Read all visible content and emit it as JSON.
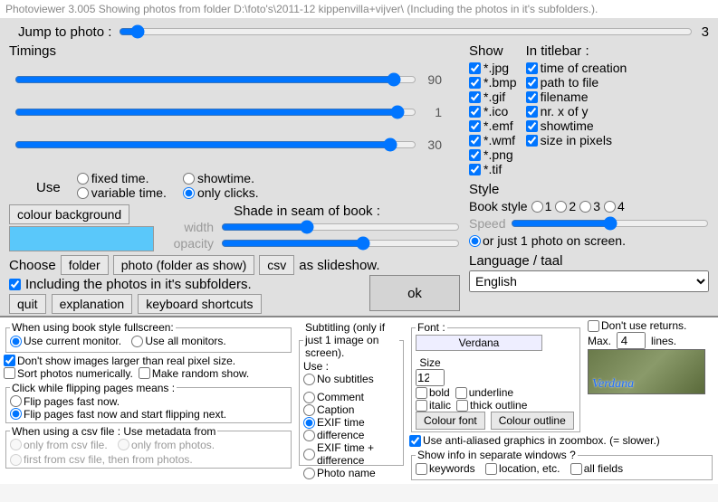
{
  "titlebar": "Photoviewer 3.005   Showing photos from folder D:\\foto's\\2011-12 kippenvilla+vijver\\  (Including the photos in it's subfolders.).",
  "jump": {
    "label": "Jump to photo :",
    "value": "3"
  },
  "timings": {
    "heading": "Timings",
    "vals": [
      "90",
      "1",
      "30"
    ],
    "use_label": "Use",
    "opts": {
      "fixed": "fixed time.",
      "showtime": "showtime.",
      "variable": "variable time.",
      "clicks": "only clicks."
    }
  },
  "colour_bg_btn": "colour background",
  "shade": {
    "title": "Shade in seam of book :",
    "width": "width",
    "opacity": "opacity"
  },
  "choose": {
    "label": "Choose",
    "folder": "folder",
    "photo": "photo (folder as show)",
    "csv": "csv",
    "tail": "as slideshow.",
    "subfolders": "Including the photos in it's subfolders."
  },
  "buttons": {
    "quit": "quit",
    "explanation": "explanation",
    "shortcuts": "keyboard shortcuts",
    "ok": "ok"
  },
  "show": {
    "heading": "Show",
    "items": [
      "*.jpg",
      "*.bmp",
      "*.gif",
      "*.ico",
      "*.emf",
      "*.wmf",
      "*.png",
      "*.tif"
    ]
  },
  "titlebar_opts": {
    "heading": "In titlebar :",
    "items": [
      "time of creation",
      "path to file",
      "filename",
      "nr. x of y",
      "showtime",
      "size in pixels"
    ]
  },
  "style": {
    "heading": "Style",
    "book_label": "Book style",
    "opts": [
      "1",
      "2",
      "3",
      "4"
    ],
    "speed": "Speed",
    "one_photo": "or just 1 photo on screen."
  },
  "language": {
    "heading": "Language / taal",
    "value": "English"
  },
  "fullscreen": {
    "legend": "When using book style fullscreen:",
    "current": "Use current monitor.",
    "all": "Use all monitors."
  },
  "dontshow": "Don't show images larger than real pixel size.",
  "sortnum": "Sort photos numerically.",
  "random": "Make random show.",
  "flip": {
    "legend": "Click while flipping pages means :",
    "fast": "Flip pages fast now.",
    "fastnext": "Flip pages fast now and start flipping next."
  },
  "csvmeta": {
    "legend": "When using a csv file : Use metadata from",
    "csv": "only from csv file.",
    "photos": "only from photos.",
    "both": "first from csv file, then from photos."
  },
  "subtitling": {
    "legend": "Subtitling (only if just 1 image on screen).",
    "use": "Use :",
    "none": "No subtitles",
    "comment": "Comment",
    "caption": "Caption",
    "exif": "EXIF time",
    "diff": "difference",
    "exifdiff": "EXIF time + difference",
    "photoname": "Photo name"
  },
  "font": {
    "legend": "Font :",
    "name": "Verdana",
    "size_label": "Size",
    "size": "12",
    "bold": "bold",
    "underline": "underline",
    "italic": "italic",
    "thick": "thick outline",
    "colour_font": "Colour font",
    "colour_outline": "Colour outline"
  },
  "returns": {
    "dont": "Don't use returns.",
    "max": "Max.",
    "lines": "lines.",
    "val": "4"
  },
  "antialias": "Use anti-aliased graphics in zoombox. (= slower.)",
  "showinfo": {
    "legend": "Show info in separate windows ?",
    "keywords": "keywords",
    "location": "location, etc.",
    "all": "all fields"
  },
  "preview_text": "Verdana"
}
